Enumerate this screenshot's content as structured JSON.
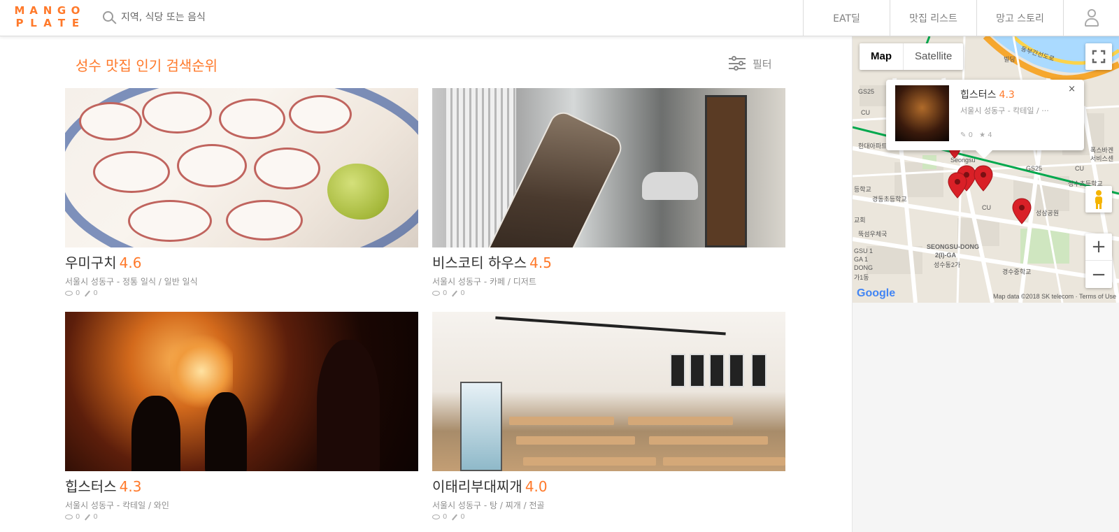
{
  "header": {
    "logo_top": [
      "M",
      "A",
      "N",
      "G",
      "O"
    ],
    "logo_bottom": [
      "P",
      "L",
      "A",
      "T",
      "E"
    ],
    "search_placeholder": "지역, 식당 또는 음식",
    "nav": {
      "eat_deal": "EAT딜",
      "restaurant_list": "맛집 리스트",
      "mango_story": "망고 스토리"
    }
  },
  "main": {
    "title": "성수 맛집 인기 검색순위",
    "filter_label": "필터",
    "cards": [
      {
        "name": "우미구치",
        "score": "4.6",
        "meta": "서울시 성동구 - 정통 일식 / 일반 일식",
        "views": "0",
        "reviews": "0"
      },
      {
        "name": "비스코티 하우스",
        "score": "4.5",
        "meta": "서울시 성동구 - 카페 / 디저트",
        "views": "0",
        "reviews": "0"
      },
      {
        "name": "힙스터스",
        "score": "4.3",
        "meta": "서울시 성동구 - 칵테일 / 와인",
        "views": "0",
        "reviews": "0"
      },
      {
        "name": "이태리부대찌개",
        "score": "4.0",
        "meta": "서울시 성동구 - 탕 / 찌개 / 전골",
        "views": "0",
        "reviews": "0"
      }
    ]
  },
  "map": {
    "type_map": "Map",
    "type_satellite": "Satellite",
    "zoom_in": "+",
    "zoom_out": "−",
    "close": "×",
    "google": "Google",
    "footer": "Map data ©2018 SK telecom · Terms of Use",
    "infowindow": {
      "name": "힙스터스",
      "score": "4.3",
      "meta": "서울시 성동구 - 칵테일 / ···",
      "reviews": "0",
      "stars": "4"
    },
    "labels": {
      "seongsu": "Seongsu",
      "gs25_a": "GS25",
      "gs25_b": "GS25",
      "gs25_c": "GS25",
      "cu_a": "CU",
      "cu_b": "CU",
      "cu_c": "CU",
      "school1": "경동초등학교",
      "school2": "경수중학교",
      "park": "성삼공원",
      "church": "뚝섬우체국",
      "hanyang": "한대아파트",
      "dong": "SEONGSU-DONG",
      "dong2": "2(I)-GA",
      "dong3": "성수동2가",
      "gsu": "GSU 1",
      "ga": "GA 1",
      "dong_en": "DONG",
      "ga_ko": "가1동",
      "building": "빌딩",
      "road": "동부간선도로",
      "right1": "폭스바겐",
      "right2": "서비스센",
      "church2": "교회",
      "school3": "등학교",
      "daelim": "성수초등학교"
    }
  }
}
